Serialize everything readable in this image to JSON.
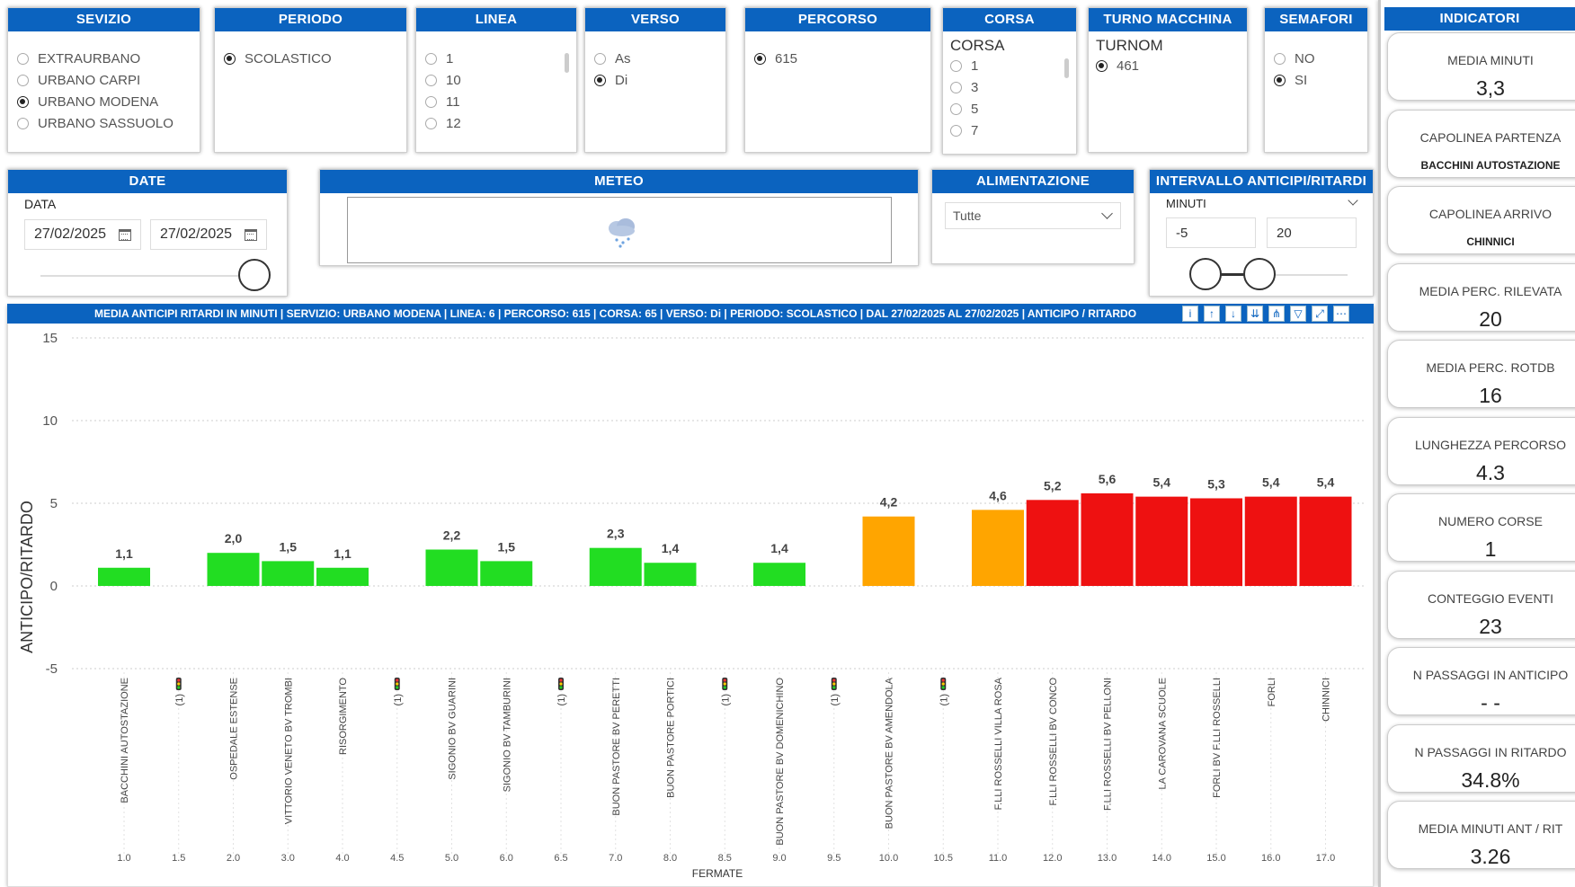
{
  "slicers": {
    "servizio": {
      "title": "SEVIZIO",
      "options": [
        {
          "label": "EXTRAURBANO",
          "selected": false
        },
        {
          "label": "URBANO CARPI",
          "selected": false
        },
        {
          "label": "URBANO MODENA",
          "selected": true
        },
        {
          "label": "URBANO SASSUOLO",
          "selected": false
        }
      ]
    },
    "periodo": {
      "title": "PERIODO",
      "options": [
        {
          "label": "SCOLASTICO",
          "selected": true
        }
      ]
    },
    "linea": {
      "title": "LINEA",
      "options": [
        {
          "label": "1",
          "selected": false
        },
        {
          "label": "10",
          "selected": false
        },
        {
          "label": "11",
          "selected": false
        },
        {
          "label": "12",
          "selected": false
        }
      ]
    },
    "verso": {
      "title": "VERSO",
      "options": [
        {
          "label": "As",
          "selected": false
        },
        {
          "label": "Di",
          "selected": true
        }
      ]
    },
    "percorso": {
      "title": "PERCORSO",
      "options": [
        {
          "label": "615",
          "selected": true
        }
      ]
    },
    "corsa": {
      "title": "CORSA",
      "subtitle": "CORSA",
      "options": [
        {
          "label": "1",
          "selected": false
        },
        {
          "label": "3",
          "selected": false
        },
        {
          "label": "5",
          "selected": false
        },
        {
          "label": "7",
          "selected": false
        }
      ]
    },
    "turno": {
      "title": "TURNO MACCHINA",
      "subtitle": "TURNOM",
      "options": [
        {
          "label": "461",
          "selected": true
        }
      ]
    },
    "semafori": {
      "title": "SEMAFORI",
      "options": [
        {
          "label": "NO",
          "selected": false
        },
        {
          "label": "SI",
          "selected": true
        }
      ]
    }
  },
  "date": {
    "title": "DATE",
    "label": "DATA",
    "from": "27/02/2025",
    "to": "27/02/2025"
  },
  "meteo": {
    "title": "METEO",
    "icon": "rain-cloud-icon"
  },
  "alimentazione": {
    "title": "ALIMENTAZIONE",
    "value": "Tutte"
  },
  "intervallo": {
    "title": "INTERVALLO ANTICIPI/RITARDI",
    "label": "MINUTI",
    "min": "-5",
    "max": "20"
  },
  "indicatori": {
    "title": "INDICATORI",
    "cards": [
      {
        "label": "MEDIA MINUTI",
        "value": "3,3",
        "small": false
      },
      {
        "label": "CAPOLINEA PARTENZA",
        "value": "BACCHINI AUTOSTAZIONE",
        "small": true
      },
      {
        "label": "CAPOLINEA ARRIVO",
        "value": "CHINNICI",
        "small": true
      },
      {
        "label": "MEDIA PERC. RILEVATA",
        "value": "20",
        "small": false
      },
      {
        "label": "MEDIA PERC. ROTDB",
        "value": "16",
        "small": false
      },
      {
        "label": "LUNGHEZZA PERCORSO",
        "value": "4.3",
        "small": false
      },
      {
        "label": "NUMERO CORSE",
        "value": "1",
        "small": false
      },
      {
        "label": "CONTEGGIO EVENTI",
        "value": "23",
        "small": false
      },
      {
        "label": "N PASSAGGI IN ANTICIPO",
        "value": "- -",
        "small": false
      },
      {
        "label": "N PASSAGGI IN RITARDO",
        "value": "34.8%",
        "small": false
      },
      {
        "label": "MEDIA MINUTI ANT / RIT",
        "value": "3.26",
        "small": false
      }
    ]
  },
  "chart_header": "MEDIA ANTICIPI RITARDI IN MINUTI | SERVIZIO: URBANO MODENA | LINEA: 6 | PERCORSO: 615 | CORSA: 65 | VERSO: Di | PERIODO: SCOLASTICO | DAL 27/02/2025 AL 27/02/2025 | ANTICIPO / RITARDO",
  "colors": {
    "green": "#22dd22",
    "orange": "#ffa500",
    "red": "#ee1111",
    "header": "#0b63bf"
  },
  "chart_data": {
    "type": "bar",
    "ylabel": "ANTICIPO/RITARDO",
    "xlabel": "FERMATE",
    "ylim": [
      -5,
      15
    ],
    "yticks": [
      -5,
      0,
      5,
      10,
      15
    ],
    "grid": true,
    "points": [
      {
        "x": "1.0",
        "stop": "BACCHINI AUTOSTAZIONE",
        "value": 1.1,
        "label": "1,1",
        "color": "green"
      },
      {
        "x": "1.5",
        "stop": "(1)",
        "value": null,
        "semaforo": true
      },
      {
        "x": "2.0",
        "stop": "OSPEDALE ESTENSE",
        "value": 2.0,
        "label": "2,0",
        "color": "green"
      },
      {
        "x": "3.0",
        "stop": "VITTORIO VENETO BV TROMBI",
        "value": 1.5,
        "label": "1,5",
        "color": "green"
      },
      {
        "x": "4.0",
        "stop": "RISORGIMENTO",
        "value": 1.1,
        "label": "1,1",
        "color": "green"
      },
      {
        "x": "4.5",
        "stop": "(1)",
        "value": null,
        "semaforo": true
      },
      {
        "x": "5.0",
        "stop": "SIGONIO BV GUARINI",
        "value": 2.2,
        "label": "2,2",
        "color": "green"
      },
      {
        "x": "6.0",
        "stop": "SIGONIO BV TAMBURINI",
        "value": 1.5,
        "label": "1,5",
        "color": "green"
      },
      {
        "x": "6.5",
        "stop": "(1)",
        "value": null,
        "semaforo": true
      },
      {
        "x": "7.0",
        "stop": "BUON PASTORE BV PERETTI",
        "value": 2.3,
        "label": "2,3",
        "color": "green"
      },
      {
        "x": "8.0",
        "stop": "BUON PASTORE PORTICI",
        "value": 1.4,
        "label": "1,4",
        "color": "green"
      },
      {
        "x": "8.5",
        "stop": "(1)",
        "value": null,
        "semaforo": true
      },
      {
        "x": "9.0",
        "stop": "BUON PASTORE BV DOMENICHINO",
        "value": 1.4,
        "label": "1,4",
        "color": "green"
      },
      {
        "x": "9.5",
        "stop": "(1)",
        "value": null,
        "semaforo": true
      },
      {
        "x": "10.0",
        "stop": "BUON PASTORE BV AMENDOLA",
        "value": 4.2,
        "label": "4,2",
        "color": "orange"
      },
      {
        "x": "10.5",
        "stop": "(1)",
        "value": null,
        "semaforo": true
      },
      {
        "x": "11.0",
        "stop": "F.LLI ROSSELLI VILLA ROSA",
        "value": 4.6,
        "label": "4,6",
        "color": "orange"
      },
      {
        "x": "12.0",
        "stop": "F.LLI ROSSELLI BV CONCO",
        "value": 5.2,
        "label": "5,2",
        "color": "red"
      },
      {
        "x": "13.0",
        "stop": "F.LLI ROSSELLI BV PELLONI",
        "value": 5.6,
        "label": "5,6",
        "color": "red"
      },
      {
        "x": "14.0",
        "stop": "LA CAROVANA SCUOLE",
        "value": 5.4,
        "label": "5,4",
        "color": "red"
      },
      {
        "x": "15.0",
        "stop": "FORLI BV F.LLI ROSSELLI",
        "value": 5.3,
        "label": "5,3",
        "color": "red"
      },
      {
        "x": "16.0",
        "stop": "FORLI",
        "value": 5.4,
        "label": "5,4",
        "color": "red"
      },
      {
        "x": "17.0",
        "stop": "CHINNICI",
        "value": 5.4,
        "label": "5,4",
        "color": "red"
      }
    ]
  }
}
